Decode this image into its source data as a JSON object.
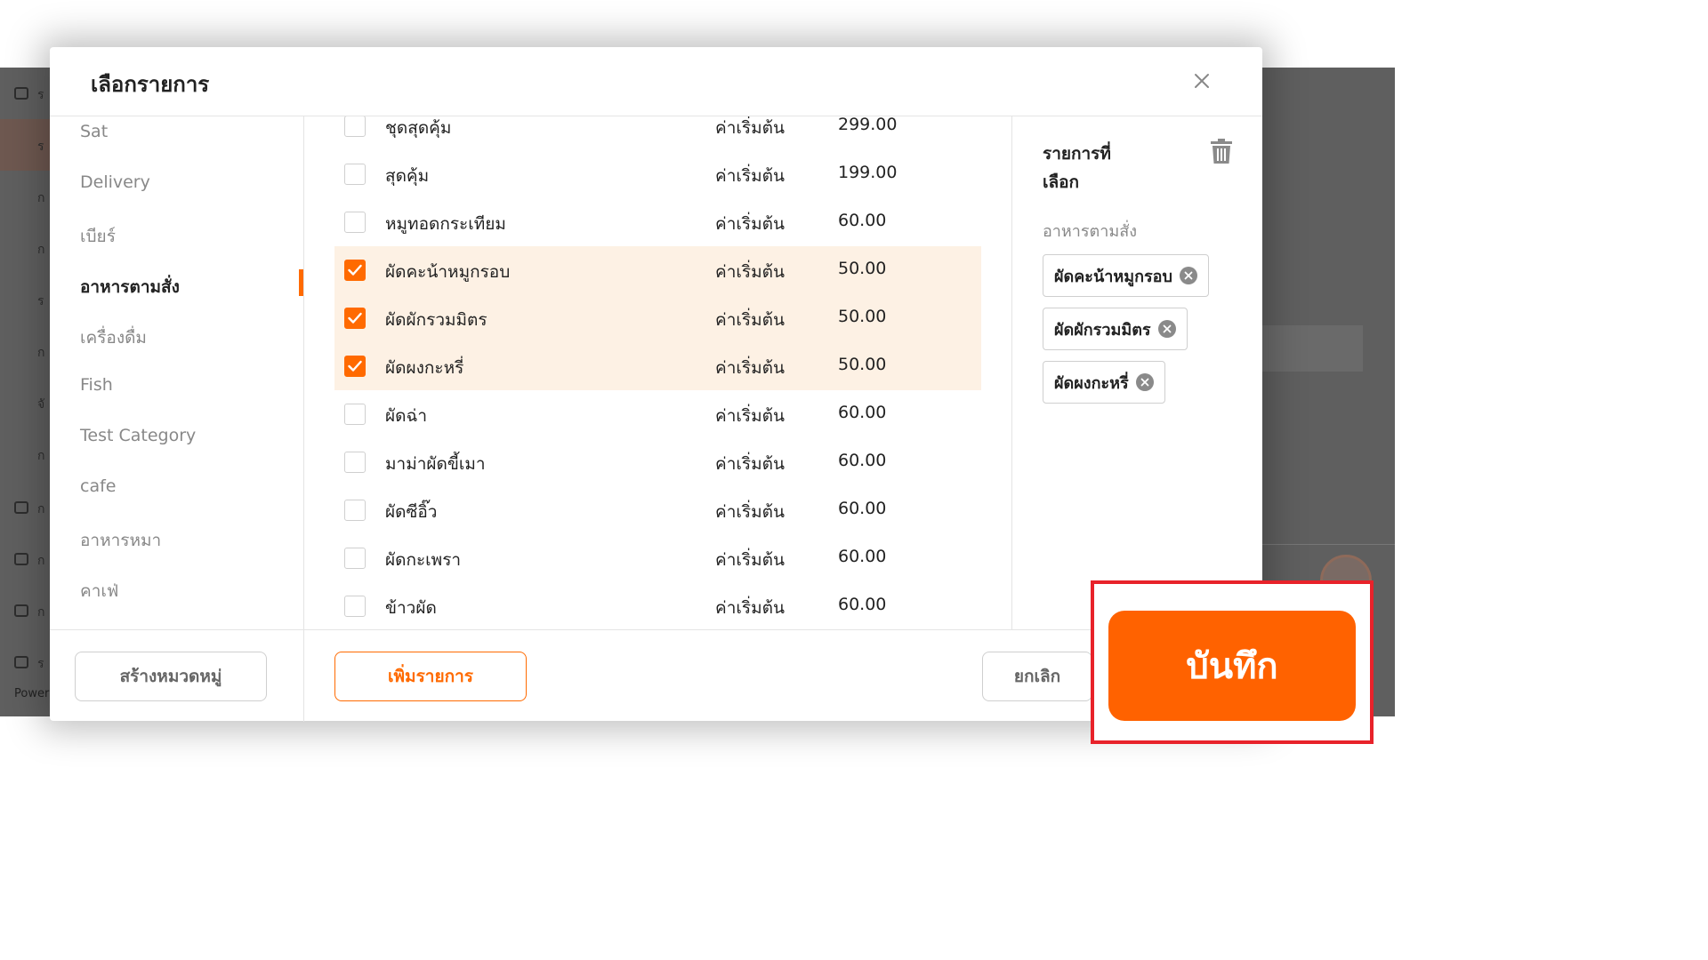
{
  "background": {
    "sidebar_glyphs": [
      "ร",
      "ร",
      "ก",
      "ก",
      "ร",
      "ก",
      "จั",
      "ก",
      "ก",
      "ก",
      "ก",
      "ร"
    ],
    "powered_text": "Power"
  },
  "modal": {
    "title": "เลือกรายการ",
    "close_icon": "close-icon"
  },
  "categories": [
    {
      "label": "Sat"
    },
    {
      "label": "Delivery"
    },
    {
      "label": "เบียร์"
    },
    {
      "label": "อาหารตามสั่ง",
      "active": true
    },
    {
      "label": "เครื่องดื่ม"
    },
    {
      "label": "Fish"
    },
    {
      "label": "Test Category"
    },
    {
      "label": "cafe"
    },
    {
      "label": "อาหารหมา"
    },
    {
      "label": "คาเฟ่"
    }
  ],
  "items": [
    {
      "name": "ชุดสุดคุ้ม",
      "label": "ค่าเริ่มต้น",
      "price": "299.00",
      "checked": false
    },
    {
      "name": "สุดคุ้ม",
      "label": "ค่าเริ่มต้น",
      "price": "199.00",
      "checked": false
    },
    {
      "name": "หมูทอดกระเทียม",
      "label": "ค่าเริ่มต้น",
      "price": "60.00",
      "checked": false
    },
    {
      "name": "ผัดคะน้าหมูกรอบ",
      "label": "ค่าเริ่มต้น",
      "price": "50.00",
      "checked": true
    },
    {
      "name": "ผัดผักรวมมิตร",
      "label": "ค่าเริ่มต้น",
      "price": "50.00",
      "checked": true
    },
    {
      "name": "ผัดผงกะหรี่",
      "label": "ค่าเริ่มต้น",
      "price": "50.00",
      "checked": true
    },
    {
      "name": "ผัดฉ่า",
      "label": "ค่าเริ่มต้น",
      "price": "60.00",
      "checked": false
    },
    {
      "name": "มาม่าผัดขี้เมา",
      "label": "ค่าเริ่มต้น",
      "price": "60.00",
      "checked": false
    },
    {
      "name": "ผัดซีอิ๊ว",
      "label": "ค่าเริ่มต้น",
      "price": "60.00",
      "checked": false
    },
    {
      "name": "ผัดกะเพรา",
      "label": "ค่าเริ่มต้น",
      "price": "60.00",
      "checked": false
    },
    {
      "name": "ข้าวผัด",
      "label": "ค่าเริ่มต้น",
      "price": "60.00",
      "checked": false
    }
  ],
  "selected_panel": {
    "title": "รายการที่เลือก",
    "category": "อาหารตามสั่ง",
    "chips": [
      "ผัดคะน้าหมูกรอบ",
      "ผัดผักรวมมิตร",
      "ผัดผงกะหรี่"
    ]
  },
  "footer": {
    "create_category": "สร้างหมวดหมู่",
    "add_item": "เพิ่มรายการ",
    "cancel": "ยกเลิก",
    "save": "บันทึก"
  },
  "colors": {
    "accent": "#ff6a00",
    "highlight": "#e8222a",
    "selected_row": "#fdf1e4"
  }
}
